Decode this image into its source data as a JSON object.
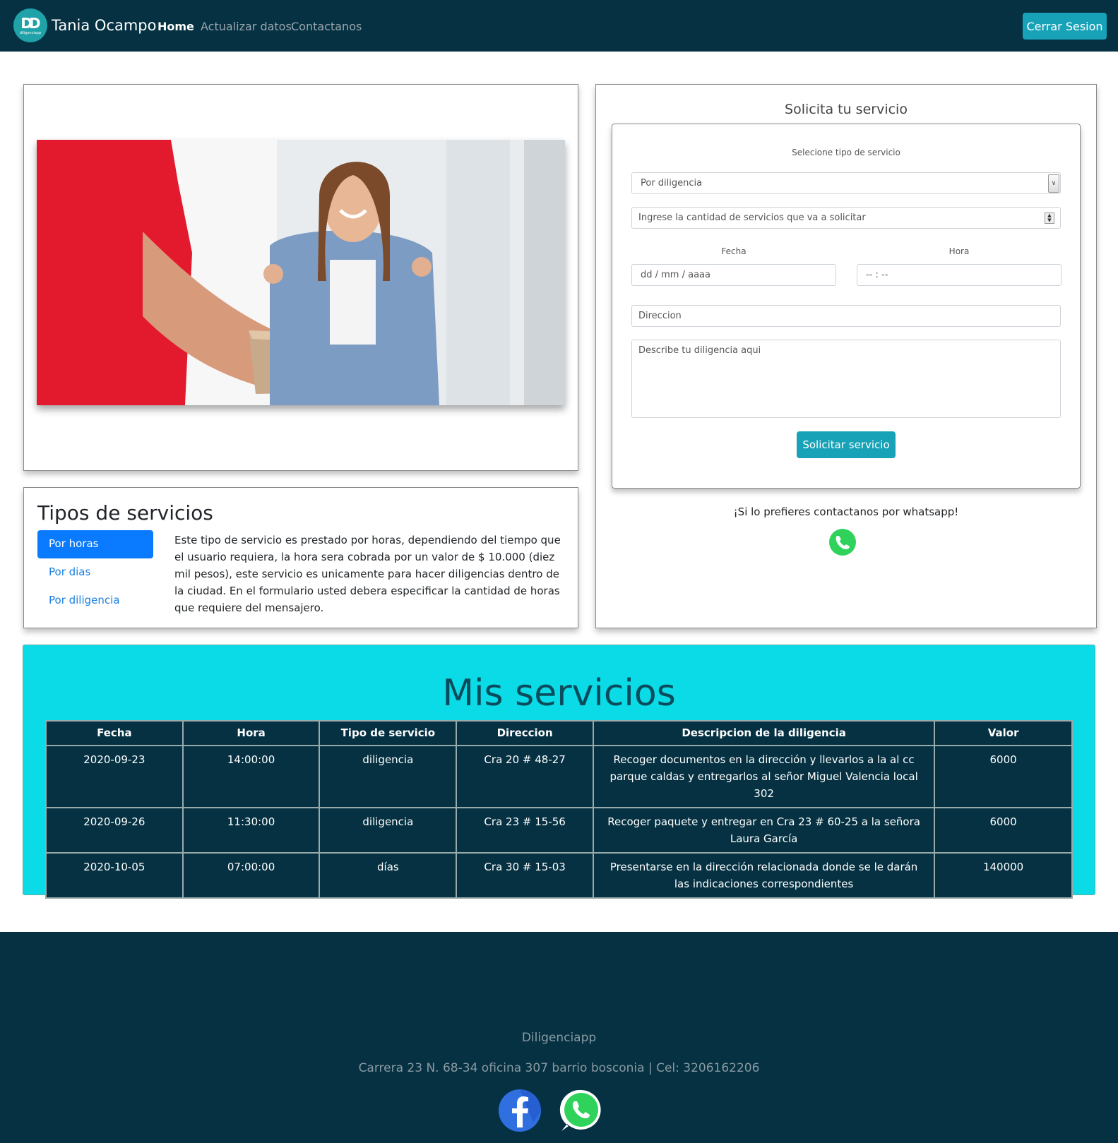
{
  "navbar": {
    "logo_text": "DD",
    "logo_sub": "diligenciapp",
    "brand": "Tania Ocampo",
    "links": [
      "Home",
      "Actualizar datos",
      "Contactanos"
    ],
    "logout_label": "Cerrar Sesion"
  },
  "tipos": {
    "title": "Tipos de servicios",
    "pills": [
      "Por horas",
      "Por dias",
      "Por diligencia"
    ],
    "active_pill": "Por horas",
    "description": "Este tipo de servicio es prestado por horas, dependiendo del tiempo que el usuario requiera, la hora sera cobrada por un valor de $ 10.000 (diez mil pesos), este servicio es unicamente para hacer diligencias dentro de la ciudad. En el formulario usted debera especificar la cantidad de horas que requiere del mensajero."
  },
  "form": {
    "title": "Solicita tu servicio",
    "select_label": "Selecione tipo de servicio",
    "select_value": "Por diligencia",
    "quantity_placeholder": "Ingrese la cantidad de servicios que va a solicitar",
    "fecha_label": "Fecha",
    "fecha_placeholder": "dd / mm / aaaa",
    "hora_label": "Hora",
    "hora_placeholder": "-- : --",
    "direccion_placeholder": "Direccion",
    "descripcion_placeholder": "Describe tu diligencia aqui",
    "submit_label": "Solicitar servicio",
    "whatsapp_text": "¡Si lo prefieres contactanos por whatsapp!"
  },
  "mis_servicios": {
    "title": "Mis servicios",
    "columns": [
      "Fecha",
      "Hora",
      "Tipo de servicio",
      "Direccion",
      "Descripcion de la diligencia",
      "Valor"
    ],
    "rows": [
      [
        "2020-09-23",
        "14:00:00",
        "diligencia",
        "Cra 20 # 48-27",
        "Recoger documentos en la dirección y llevarlos a la al cc parque caldas y entregarlos al señor Miguel Valencia local 302",
        "6000"
      ],
      [
        "2020-09-26",
        "11:30:00",
        "diligencia",
        "Cra 23 # 15-56",
        "Recoger paquete y entregar en Cra 23 # 60-25 a la señora Laura García",
        "6000"
      ],
      [
        "2020-10-05",
        "07:00:00",
        "días",
        "Cra 30 # 15-03",
        "Presentarse en la dirección relacionada donde se le darán las indicaciones correspondientes",
        "140000"
      ]
    ]
  },
  "footer": {
    "name": "Diligenciapp",
    "address": "Carrera 23 N. 68-34 oficina 307 barrio bosconia | Cel: 3206162206"
  },
  "colors": {
    "navy": "#053142",
    "teal_button": "#17a2b8",
    "cyan_panel": "#0bdbe6",
    "active_pill": "#0a7bff",
    "whatsapp": "#2fd35b",
    "facebook": "#2f6fe0"
  },
  "icons": [
    "logo-icon",
    "whatsapp-icon",
    "facebook-icon",
    "select-chevron-icon",
    "spinner-icon"
  ]
}
